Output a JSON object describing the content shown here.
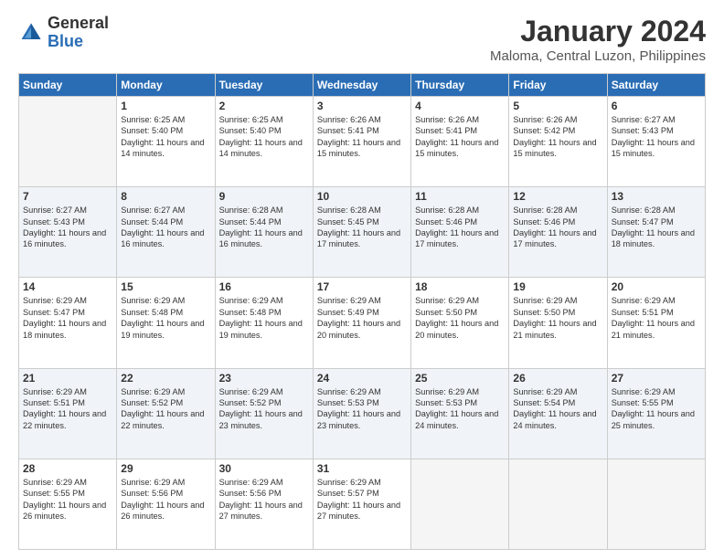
{
  "logo": {
    "general": "General",
    "blue": "Blue"
  },
  "title": {
    "month_year": "January 2024",
    "location": "Maloma, Central Luzon, Philippines"
  },
  "days_of_week": [
    "Sunday",
    "Monday",
    "Tuesday",
    "Wednesday",
    "Thursday",
    "Friday",
    "Saturday"
  ],
  "weeks": [
    [
      {
        "day": "",
        "sunrise": "",
        "sunset": "",
        "daylight": ""
      },
      {
        "day": "1",
        "sunrise": "Sunrise: 6:25 AM",
        "sunset": "Sunset: 5:40 PM",
        "daylight": "Daylight: 11 hours and 14 minutes."
      },
      {
        "day": "2",
        "sunrise": "Sunrise: 6:25 AM",
        "sunset": "Sunset: 5:40 PM",
        "daylight": "Daylight: 11 hours and 14 minutes."
      },
      {
        "day": "3",
        "sunrise": "Sunrise: 6:26 AM",
        "sunset": "Sunset: 5:41 PM",
        "daylight": "Daylight: 11 hours and 15 minutes."
      },
      {
        "day": "4",
        "sunrise": "Sunrise: 6:26 AM",
        "sunset": "Sunset: 5:41 PM",
        "daylight": "Daylight: 11 hours and 15 minutes."
      },
      {
        "day": "5",
        "sunrise": "Sunrise: 6:26 AM",
        "sunset": "Sunset: 5:42 PM",
        "daylight": "Daylight: 11 hours and 15 minutes."
      },
      {
        "day": "6",
        "sunrise": "Sunrise: 6:27 AM",
        "sunset": "Sunset: 5:43 PM",
        "daylight": "Daylight: 11 hours and 15 minutes."
      }
    ],
    [
      {
        "day": "7",
        "sunrise": "Sunrise: 6:27 AM",
        "sunset": "Sunset: 5:43 PM",
        "daylight": "Daylight: 11 hours and 16 minutes."
      },
      {
        "day": "8",
        "sunrise": "Sunrise: 6:27 AM",
        "sunset": "Sunset: 5:44 PM",
        "daylight": "Daylight: 11 hours and 16 minutes."
      },
      {
        "day": "9",
        "sunrise": "Sunrise: 6:28 AM",
        "sunset": "Sunset: 5:44 PM",
        "daylight": "Daylight: 11 hours and 16 minutes."
      },
      {
        "day": "10",
        "sunrise": "Sunrise: 6:28 AM",
        "sunset": "Sunset: 5:45 PM",
        "daylight": "Daylight: 11 hours and 17 minutes."
      },
      {
        "day": "11",
        "sunrise": "Sunrise: 6:28 AM",
        "sunset": "Sunset: 5:46 PM",
        "daylight": "Daylight: 11 hours and 17 minutes."
      },
      {
        "day": "12",
        "sunrise": "Sunrise: 6:28 AM",
        "sunset": "Sunset: 5:46 PM",
        "daylight": "Daylight: 11 hours and 17 minutes."
      },
      {
        "day": "13",
        "sunrise": "Sunrise: 6:28 AM",
        "sunset": "Sunset: 5:47 PM",
        "daylight": "Daylight: 11 hours and 18 minutes."
      }
    ],
    [
      {
        "day": "14",
        "sunrise": "Sunrise: 6:29 AM",
        "sunset": "Sunset: 5:47 PM",
        "daylight": "Daylight: 11 hours and 18 minutes."
      },
      {
        "day": "15",
        "sunrise": "Sunrise: 6:29 AM",
        "sunset": "Sunset: 5:48 PM",
        "daylight": "Daylight: 11 hours and 19 minutes."
      },
      {
        "day": "16",
        "sunrise": "Sunrise: 6:29 AM",
        "sunset": "Sunset: 5:48 PM",
        "daylight": "Daylight: 11 hours and 19 minutes."
      },
      {
        "day": "17",
        "sunrise": "Sunrise: 6:29 AM",
        "sunset": "Sunset: 5:49 PM",
        "daylight": "Daylight: 11 hours and 20 minutes."
      },
      {
        "day": "18",
        "sunrise": "Sunrise: 6:29 AM",
        "sunset": "Sunset: 5:50 PM",
        "daylight": "Daylight: 11 hours and 20 minutes."
      },
      {
        "day": "19",
        "sunrise": "Sunrise: 6:29 AM",
        "sunset": "Sunset: 5:50 PM",
        "daylight": "Daylight: 11 hours and 21 minutes."
      },
      {
        "day": "20",
        "sunrise": "Sunrise: 6:29 AM",
        "sunset": "Sunset: 5:51 PM",
        "daylight": "Daylight: 11 hours and 21 minutes."
      }
    ],
    [
      {
        "day": "21",
        "sunrise": "Sunrise: 6:29 AM",
        "sunset": "Sunset: 5:51 PM",
        "daylight": "Daylight: 11 hours and 22 minutes."
      },
      {
        "day": "22",
        "sunrise": "Sunrise: 6:29 AM",
        "sunset": "Sunset: 5:52 PM",
        "daylight": "Daylight: 11 hours and 22 minutes."
      },
      {
        "day": "23",
        "sunrise": "Sunrise: 6:29 AM",
        "sunset": "Sunset: 5:52 PM",
        "daylight": "Daylight: 11 hours and 23 minutes."
      },
      {
        "day": "24",
        "sunrise": "Sunrise: 6:29 AM",
        "sunset": "Sunset: 5:53 PM",
        "daylight": "Daylight: 11 hours and 23 minutes."
      },
      {
        "day": "25",
        "sunrise": "Sunrise: 6:29 AM",
        "sunset": "Sunset: 5:53 PM",
        "daylight": "Daylight: 11 hours and 24 minutes."
      },
      {
        "day": "26",
        "sunrise": "Sunrise: 6:29 AM",
        "sunset": "Sunset: 5:54 PM",
        "daylight": "Daylight: 11 hours and 24 minutes."
      },
      {
        "day": "27",
        "sunrise": "Sunrise: 6:29 AM",
        "sunset": "Sunset: 5:55 PM",
        "daylight": "Daylight: 11 hours and 25 minutes."
      }
    ],
    [
      {
        "day": "28",
        "sunrise": "Sunrise: 6:29 AM",
        "sunset": "Sunset: 5:55 PM",
        "daylight": "Daylight: 11 hours and 26 minutes."
      },
      {
        "day": "29",
        "sunrise": "Sunrise: 6:29 AM",
        "sunset": "Sunset: 5:56 PM",
        "daylight": "Daylight: 11 hours and 26 minutes."
      },
      {
        "day": "30",
        "sunrise": "Sunrise: 6:29 AM",
        "sunset": "Sunset: 5:56 PM",
        "daylight": "Daylight: 11 hours and 27 minutes."
      },
      {
        "day": "31",
        "sunrise": "Sunrise: 6:29 AM",
        "sunset": "Sunset: 5:57 PM",
        "daylight": "Daylight: 11 hours and 27 minutes."
      },
      {
        "day": "",
        "sunrise": "",
        "sunset": "",
        "daylight": ""
      },
      {
        "day": "",
        "sunrise": "",
        "sunset": "",
        "daylight": ""
      },
      {
        "day": "",
        "sunrise": "",
        "sunset": "",
        "daylight": ""
      }
    ]
  ]
}
